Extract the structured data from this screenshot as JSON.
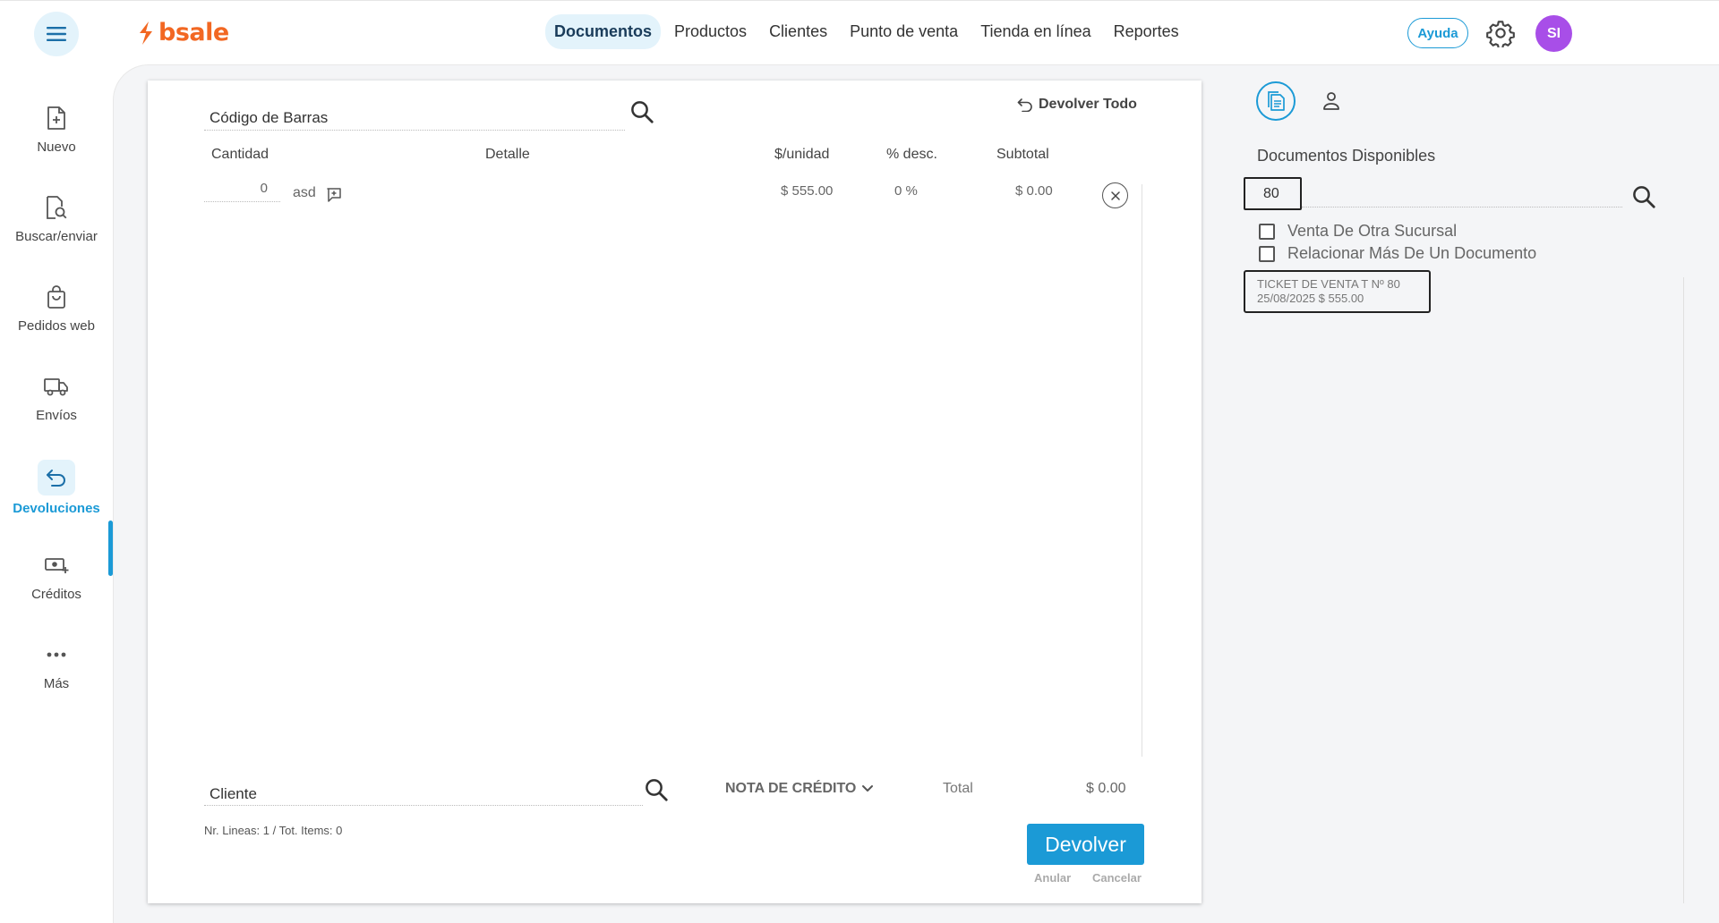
{
  "header": {
    "logo_text": "bsale",
    "nav": [
      {
        "label": "Documentos",
        "active": true
      },
      {
        "label": "Productos",
        "active": false
      },
      {
        "label": "Clientes",
        "active": false
      },
      {
        "label": "Punto de venta",
        "active": false
      },
      {
        "label": "Tienda en línea",
        "active": false
      },
      {
        "label": "Reportes",
        "active": false
      }
    ],
    "help_label": "Ayuda",
    "avatar_initials": "SI"
  },
  "sidebar": {
    "items": [
      {
        "label": "Nuevo",
        "icon": "new-document-icon"
      },
      {
        "label": "Buscar/enviar",
        "icon": "search-document-icon"
      },
      {
        "label": "Pedidos web",
        "icon": "shopping-bag-icon"
      },
      {
        "label": "Envíos",
        "icon": "truck-icon"
      },
      {
        "label": "Devoluciones",
        "icon": "return-icon",
        "active": true
      },
      {
        "label": "Créditos",
        "icon": "credit-money-icon"
      },
      {
        "label": "Más",
        "icon": "more-dots-icon"
      }
    ]
  },
  "main": {
    "barcode_placeholder": "Código de Barras",
    "return_all_label": "Devolver Todo",
    "columns": {
      "cantidad": "Cantidad",
      "detalle": "Detalle",
      "unit_price": "$/unidad",
      "discount": "% desc.",
      "subtotal": "Subtotal"
    },
    "rows": [
      {
        "cantidad": "0",
        "detalle": "asd",
        "unit_price": "$ 555.00",
        "discount": "0 %",
        "subtotal": "$ 0.00"
      }
    ],
    "client_placeholder": "Cliente",
    "doc_type": "NOTA DE CRÉDITO",
    "total_label": "Total",
    "total_value": "$ 0.00",
    "lines_info": "Nr. Lineas: 1 / Tot. Items: 0",
    "submit_label": "Devolver",
    "void_label": "Anular",
    "cancel_label": "Cancelar"
  },
  "right_panel": {
    "title": "Documentos Disponibles",
    "search_value": "80",
    "checkboxes": [
      {
        "label": "Venta De Otra Sucursal",
        "checked": false
      },
      {
        "label": "Relacionar Más De Un Documento",
        "checked": false
      }
    ],
    "documents": [
      {
        "line1": "TICKET DE VENTA T Nº 80",
        "line2": "25/08/2025 $ 555.00"
      }
    ]
  },
  "colors": {
    "accent": "#1b9ad6",
    "brand": "#f26722",
    "avatar": "#a84ee8"
  }
}
